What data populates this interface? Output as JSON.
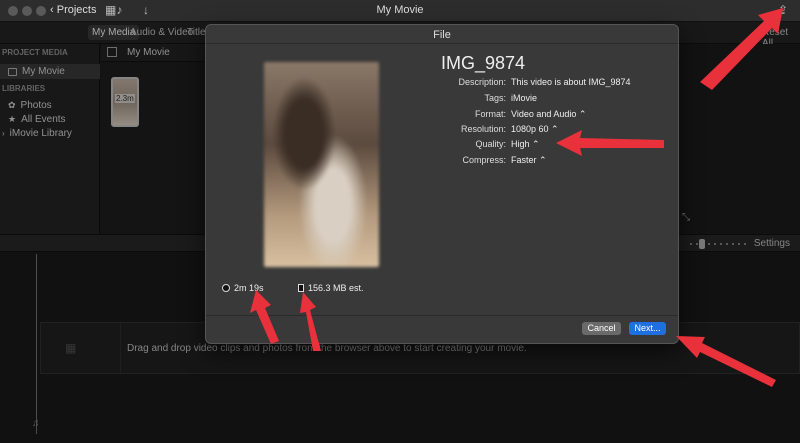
{
  "window": {
    "title": "My Movie",
    "projects_label": "Projects"
  },
  "tabs": {
    "my_media": "My Media",
    "audio_video": "Audio & Video",
    "titles": "Titles",
    "reset_all": "Reset All"
  },
  "sidebar": {
    "project_media_header": "PROJECT MEDIA",
    "libraries_header": "LIBRARIES",
    "items": [
      {
        "label": "My Movie",
        "icon": "film-icon"
      },
      {
        "label": "Photos",
        "icon": "photos-icon"
      },
      {
        "label": "All Events",
        "icon": "star-icon"
      },
      {
        "label": "iMovie Library",
        "icon": "disclosure-icon"
      }
    ]
  },
  "browser": {
    "title": "My Movie",
    "clip_duration": "2.3m"
  },
  "timeline": {
    "settings_label": "Settings",
    "drag_hint": "Drag and drop video clips and photos from the browser above to start creating your movie."
  },
  "dialog": {
    "title": "File",
    "file_name": "IMG_9874",
    "fields": [
      {
        "label": "Description:",
        "value": "This video is about IMG_9874"
      },
      {
        "label": "Tags:",
        "value": "iMovie"
      },
      {
        "label": "Format:",
        "value": "Video and Audio ⌃"
      },
      {
        "label": "Resolution:",
        "value": "1080p 60 ⌃"
      },
      {
        "label": "Quality:",
        "value": "High ⌃"
      },
      {
        "label": "Compress:",
        "value": "Faster ⌃"
      }
    ],
    "duration": "2m 19s",
    "size": "156.3 MB est.",
    "cancel_label": "Cancel",
    "next_label": "Next..."
  },
  "colors": {
    "arrow": "#e8313b",
    "accent": "#1f6fe0"
  }
}
